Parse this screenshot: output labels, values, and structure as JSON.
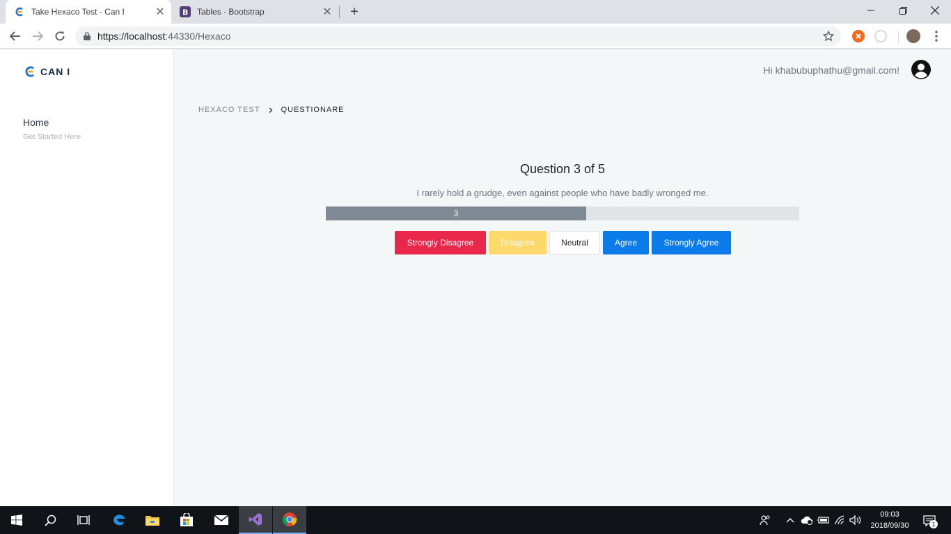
{
  "browser": {
    "tabs": [
      {
        "title": "Take Hexaco Test - Can I",
        "active": true,
        "favicon": "cani-logo-icon"
      },
      {
        "title": "Tables · Bootstrap",
        "active": false,
        "favicon": "bootstrap-icon"
      }
    ],
    "new_tab_symbol": "+",
    "close_symbol": "✕",
    "url_host": "https://localhost",
    "url_rest": ":44330/Hexaco"
  },
  "app": {
    "brand": "CAN I",
    "sidebar": {
      "home_label": "Home",
      "home_sub": "Get Started Here"
    },
    "greeting": "Hi khabubuphathu@gmail.com!",
    "breadcrumb": [
      "HEXACO TEST",
      "QUESTIONARE"
    ],
    "question": {
      "title": "Question 3 of 5",
      "text": "I rarely hold a grudge, even against people who have badly wronged me.",
      "progress_label": "3",
      "progress_fraction": 0.55
    },
    "answers": [
      "Strongly Disagree",
      "Disagree",
      "Neutral",
      "Agree",
      "Strongly Agree"
    ]
  },
  "taskbar": {
    "time": "09:03",
    "date": "2018/09/30",
    "notification_count": "1"
  },
  "colors": {
    "strongly_disagree": "#e8274b",
    "disagree": "#fdd86b",
    "agree": "#0a7be9",
    "progress_fill": "#7e8993"
  }
}
